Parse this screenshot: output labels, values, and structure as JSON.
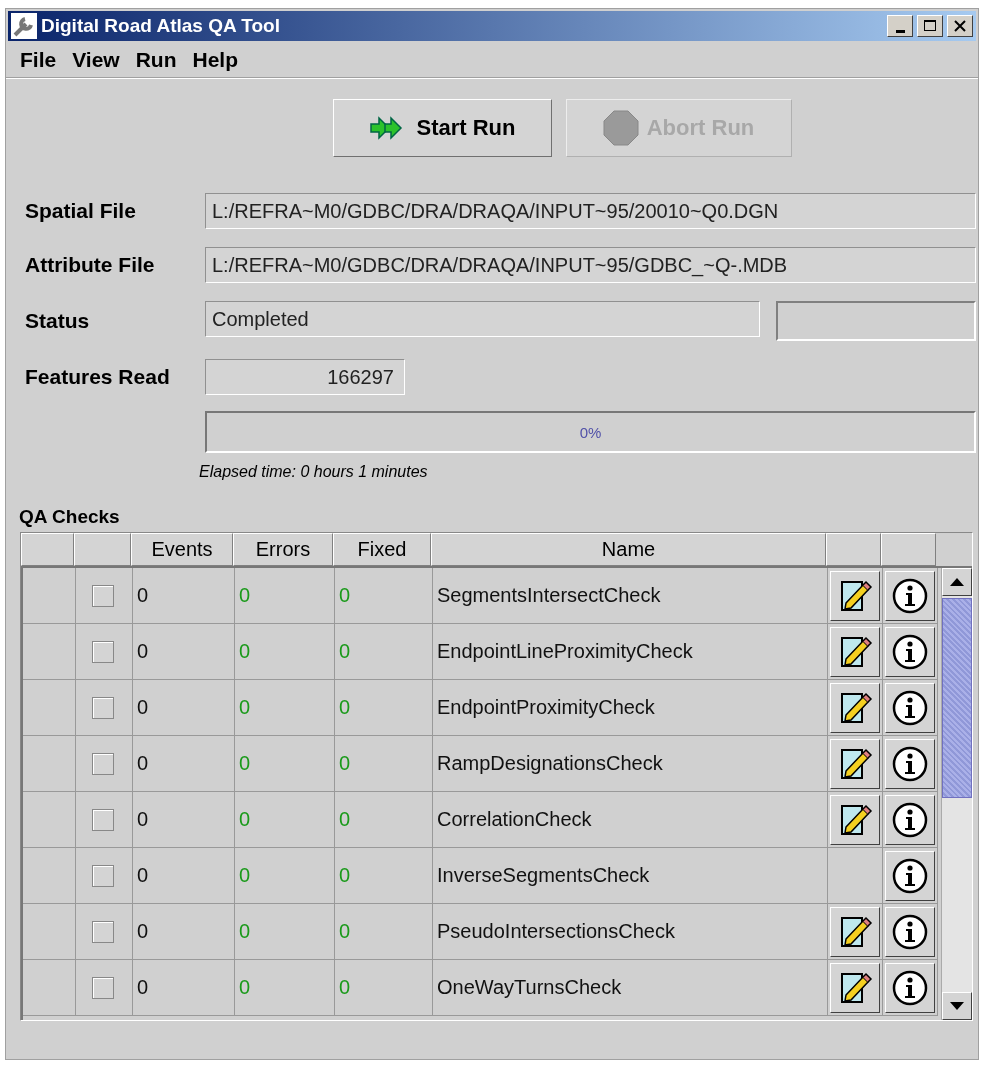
{
  "window": {
    "title": "Digital Road Atlas QA Tool"
  },
  "menu": [
    "File",
    "View",
    "Run",
    "Help"
  ],
  "toolbar": [
    {
      "label": "Start Run",
      "kind": "start",
      "disabled": false
    },
    {
      "label": "Abort Run",
      "kind": "stop",
      "disabled": true
    }
  ],
  "fields": [
    {
      "label": "Spatial File",
      "value": "L:/REFRA~M0/GDBC/DRA/DRAQA/INPUT~95/20010~Q0.DGN",
      "kind": "wide"
    },
    {
      "label": "Attribute File",
      "value": "L:/REFRA~M0/GDBC/DRA/DRAQA/INPUT~95/GDBC_~Q-.MDB",
      "kind": "wide"
    },
    {
      "label": "Status",
      "value": "Completed",
      "kind": "status"
    },
    {
      "label": "Features Read",
      "value": "166297",
      "kind": "number"
    }
  ],
  "progress": {
    "level": 0,
    "reading": "0%"
  },
  "elapsed": "Elapsed time: 0 hours 1 minutes",
  "qa_checks": {
    "title": "QA Checks",
    "columns": [
      "Events",
      "Errors",
      "Fixed",
      "Name"
    ],
    "rows": [
      {
        "checked": false,
        "events": "0",
        "errors": "0",
        "fixed": "0",
        "name": "SegmentsIntersectCheck",
        "editable": true
      },
      {
        "checked": false,
        "events": "0",
        "errors": "0",
        "fixed": "0",
        "name": "EndpointLineProximityCheck",
        "editable": true
      },
      {
        "checked": false,
        "events": "0",
        "errors": "0",
        "fixed": "0",
        "name": "EndpointProximityCheck",
        "editable": true
      },
      {
        "checked": false,
        "events": "0",
        "errors": "0",
        "fixed": "0",
        "name": "RampDesignationsCheck",
        "editable": true
      },
      {
        "checked": false,
        "events": "0",
        "errors": "0",
        "fixed": "0",
        "name": "CorrelationCheck",
        "editable": true
      },
      {
        "checked": false,
        "events": "0",
        "errors": "0",
        "fixed": "0",
        "name": "InverseSegmentsCheck",
        "editable": false
      },
      {
        "checked": false,
        "events": "0",
        "errors": "0",
        "fixed": "0",
        "name": "PseudoIntersectionsCheck",
        "editable": true
      },
      {
        "checked": false,
        "events": "0",
        "errors": "0",
        "fixed": "0",
        "name": "OneWayTurnsCheck",
        "editable": true
      }
    ]
  }
}
